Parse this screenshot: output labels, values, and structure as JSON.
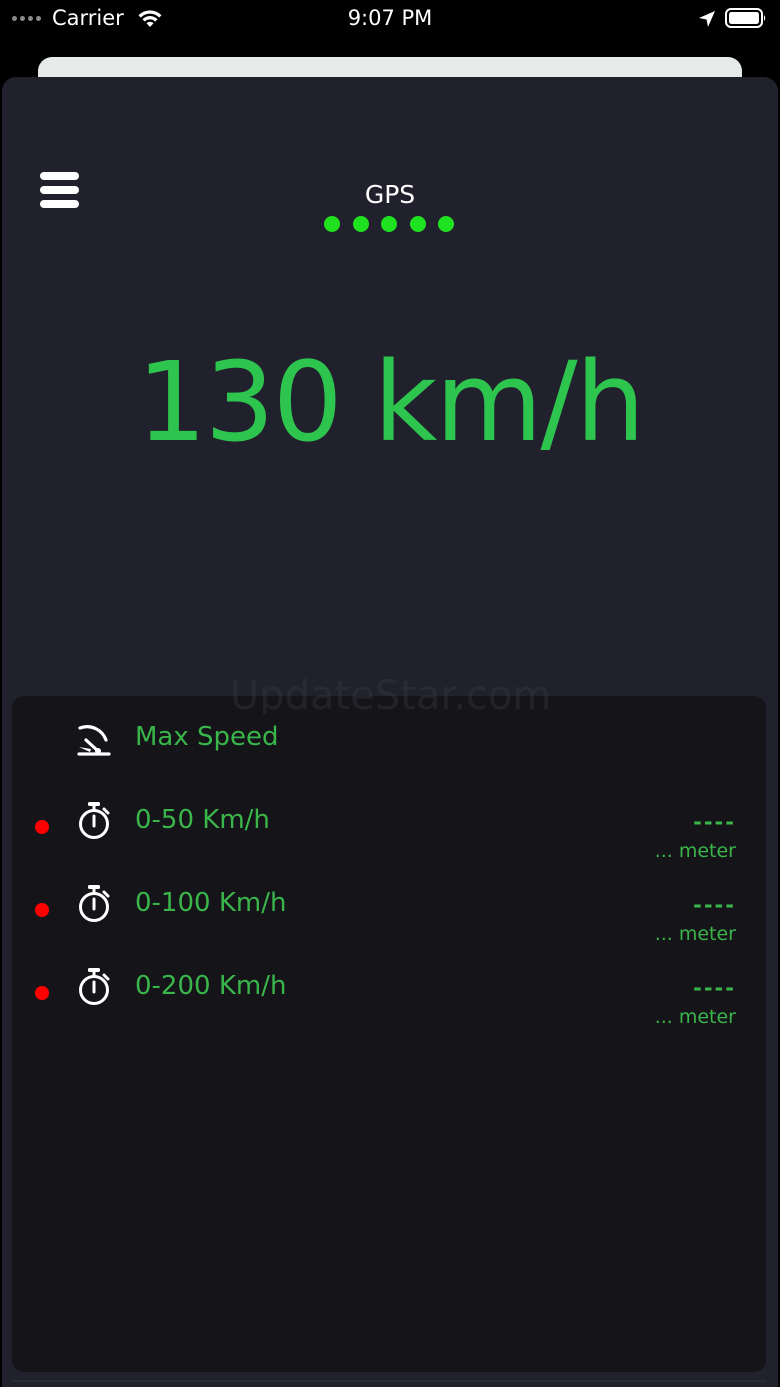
{
  "status_bar": {
    "carrier": "Carrier",
    "time": "9:07 PM",
    "icons": [
      "signal-icon",
      "wifi-icon",
      "location-arrow-icon",
      "battery-icon"
    ]
  },
  "header": {
    "menu_icon": "hamburger-menu-icon",
    "gps_label": "GPS",
    "gps_signal_bars": 5,
    "gps_dot_color": "#1fe11f"
  },
  "speed": {
    "value": "130 km/h",
    "color": "#2ec54f"
  },
  "watermark": "UpdateStar.com",
  "stats": {
    "max_speed": {
      "icon": "speedometer-icon",
      "label": "Max Speed"
    },
    "timers": [
      {
        "icon": "stopwatch-icon",
        "label": "0-50 Km/h",
        "value": "----",
        "distance": "... meter",
        "status_color": "#ff0000"
      },
      {
        "icon": "stopwatch-icon",
        "label": "0-100 Km/h",
        "value": "----",
        "distance": "... meter",
        "status_color": "#ff0000"
      },
      {
        "icon": "stopwatch-icon",
        "label": "0-200 Km/h",
        "value": "----",
        "distance": "... meter",
        "status_color": "#ff0000"
      }
    ]
  },
  "colors": {
    "background": "#21212d",
    "panel": "#141419",
    "accent_green": "#3ab54a"
  }
}
